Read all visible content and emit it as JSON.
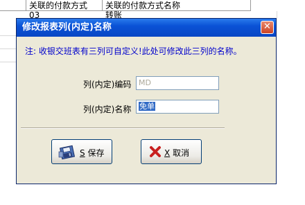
{
  "background": {
    "columns": [
      "",
      "关联的付款方式",
      "关联的付款方式名称"
    ],
    "partial_row": [
      "",
      "03",
      "转账"
    ]
  },
  "dialog": {
    "title": "修改报表列(内定)名称",
    "close_glyph": "✕",
    "note": "注: 收银交班表有三列可自定义!此处可修改此三列的名称。",
    "code_label": "列(内定)编码",
    "code_value": "MD",
    "name_label": "列(内定)名称",
    "name_value": "免单",
    "save_key": "S",
    "save_label": "保存",
    "cancel_key": "X",
    "cancel_label": "取消"
  },
  "icons": {
    "save": "floppy-disk-icon",
    "cancel": "red-x-icon",
    "close": "close-icon"
  },
  "colors": {
    "titlebar": "#0a52d6",
    "note_text": "#0000cc",
    "dialog_bg": "#ece9d8",
    "cancel_icon": "#c8201f"
  }
}
